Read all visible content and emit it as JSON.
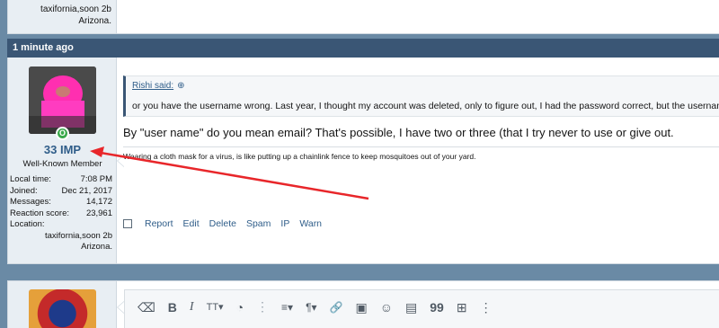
{
  "prev_user": {
    "location_line1": "taxifornia,soon 2b",
    "location_line2": "Arizona."
  },
  "post": {
    "time": "1 minute ago",
    "user": {
      "name": "33 IMP",
      "title": "Well-Known Member",
      "stats": [
        {
          "label": "Local time:",
          "value": "7:08 PM"
        },
        {
          "label": "Joined:",
          "value": "Dec 21, 2017"
        },
        {
          "label": "Messages:",
          "value": "14,172"
        },
        {
          "label": "Reaction score:",
          "value": "23,961"
        }
      ],
      "location_label": "Location:",
      "location_line1": "taxifornia,soon 2b",
      "location_line2": "Arizona.",
      "online_badge": "O"
    },
    "quote": {
      "author": "Rishi said:",
      "text": "or you have the username wrong. Last year, I thought my account was deleted, only to figure out, I had the password correct, but the username"
    },
    "message": "By \"user name\" do you mean email? That's possible, I have two or three (that I try never to use or give out.",
    "signature": "Wearing a cloth mask for a virus, is like putting up a chainlink fence to keep mosquitoes out of your yard.",
    "actions": [
      "Report",
      "Edit",
      "Delete",
      "Spam",
      "IP",
      "Warn"
    ]
  },
  "editor": {
    "toolbar_icons": [
      "eraser-icon",
      "bold-icon",
      "italic-icon",
      "text-size-icon",
      "palette-icon",
      "more-icon",
      "align-icon",
      "paragraph-icon",
      "link-icon",
      "image-icon",
      "emoji-icon",
      "media-icon",
      "quote-icon",
      "table-icon",
      "more-icon"
    ],
    "toolbar_glyphs": {
      "eraser": "⌫",
      "bold": "B",
      "italic": "I",
      "text_size": "TT▾",
      "palette": "◔",
      "more1": "⋮",
      "align": "≡▾",
      "paragraph": "¶▾",
      "link": "🔗",
      "image": "▣",
      "emoji": "☺",
      "media": "▤",
      "quote": "99",
      "table": "⊞",
      "more2": "⋮"
    }
  },
  "colors": {
    "accent": "#3a5675",
    "link": "#2f5d89",
    "annotation": "#e8262a",
    "online": "#3aa94b"
  }
}
